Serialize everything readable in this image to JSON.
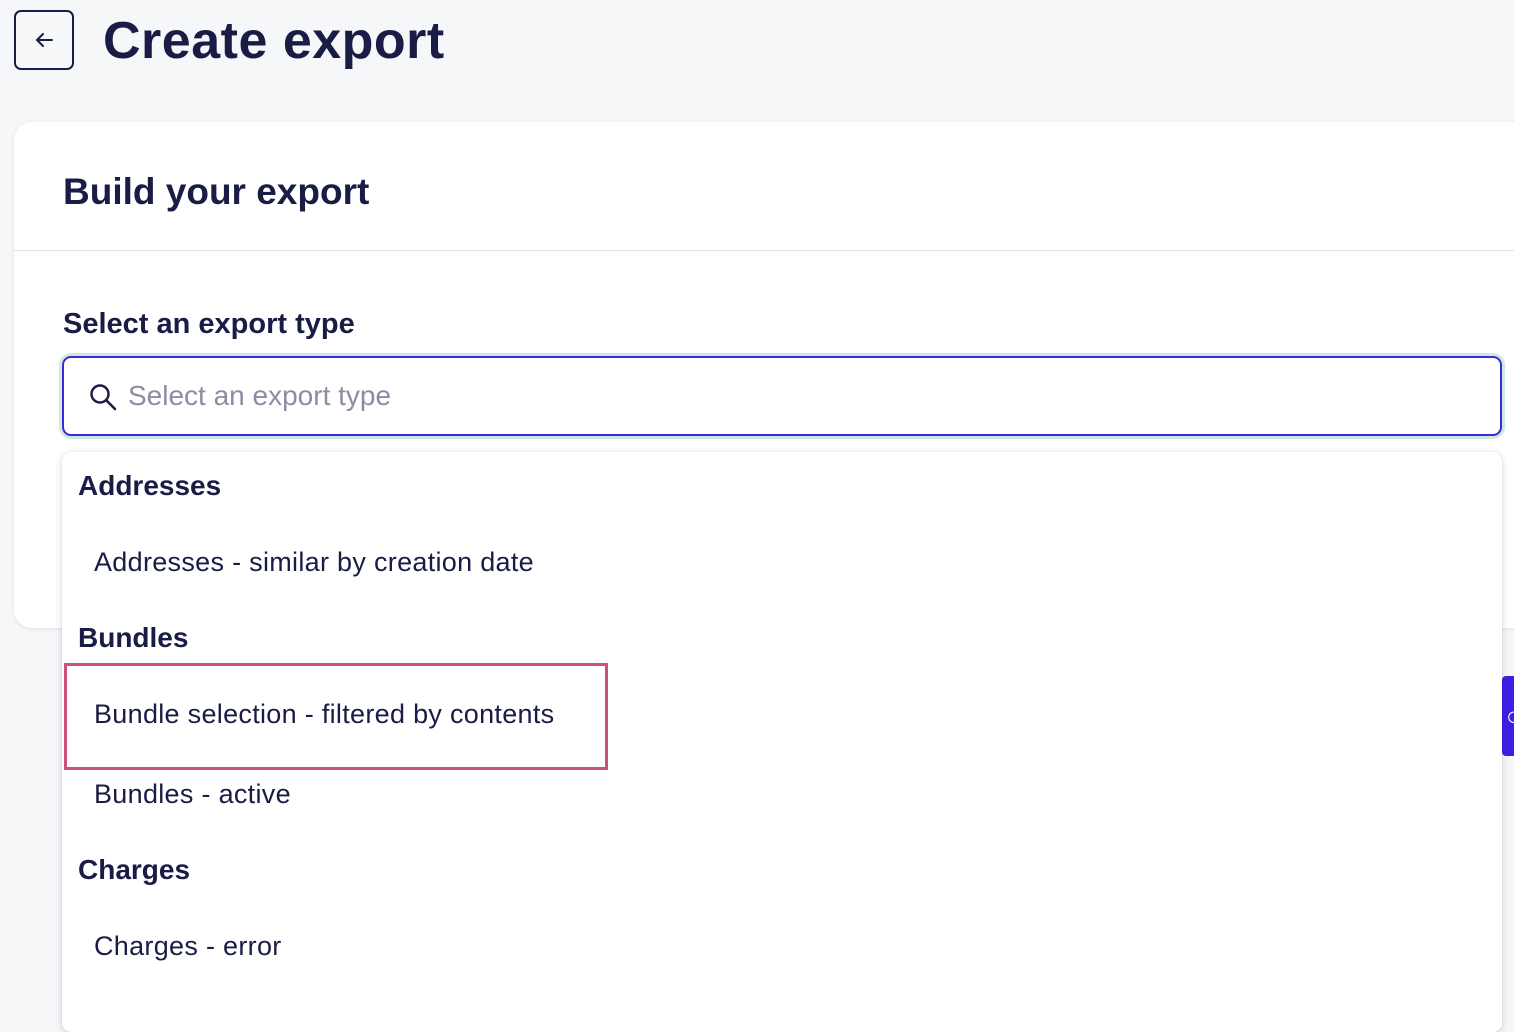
{
  "header": {
    "back_icon": "arrow-left-icon",
    "title": "Create export"
  },
  "card": {
    "title": "Build your export",
    "field_label": "Select an export type"
  },
  "search": {
    "icon": "search-icon",
    "placeholder": "Select an export type",
    "value": ""
  },
  "dropdown": {
    "groups": [
      {
        "label": "Addresses",
        "options": [
          "Addresses - similar by creation date"
        ]
      },
      {
        "label": "Bundles",
        "options": [
          "Bundle selection - filtered by contents",
          "Bundles - active"
        ]
      },
      {
        "label": "Charges",
        "options": [
          "Charges - error"
        ]
      }
    ],
    "highlighted_option": "Bundle selection - filtered by contents"
  },
  "colors": {
    "primary_text": "#191c45",
    "accent": "#3d2ad6",
    "focus_ring": "#cfe9e4",
    "highlight": "#cc4f7f",
    "side_button": "#3d1ee6"
  }
}
